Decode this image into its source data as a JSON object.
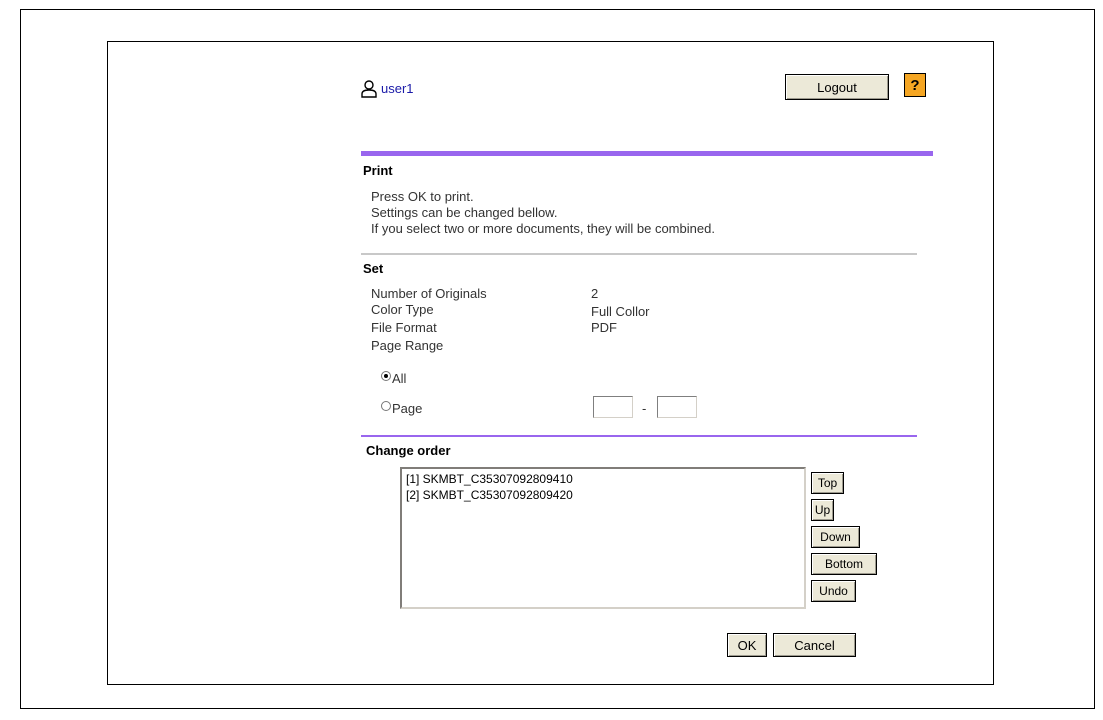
{
  "header": {
    "username": "user1",
    "logout_label": "Logout",
    "help_label": "?"
  },
  "print": {
    "title": "Print",
    "lines": [
      "Press OK to print.",
      "Settings can be changed bellow.",
      "If you select two or more documents, they will be combined."
    ]
  },
  "set": {
    "title": "Set",
    "rows": [
      {
        "label": "Number of Originals",
        "value": "2"
      },
      {
        "label": "Color Type",
        "value": "Full Collor"
      },
      {
        "label": "File Format",
        "value": "PDF"
      },
      {
        "label": "Page Range",
        "value": ""
      }
    ],
    "page_range": {
      "all_label": "All",
      "page_label": "Page",
      "selected": "All",
      "from": "",
      "to": "",
      "separator": "-"
    }
  },
  "change_order": {
    "title": "Change order",
    "items": [
      "[1] SKMBT_C35307092809410",
      "[2] SKMBT_C35307092809420"
    ],
    "buttons": {
      "top": "Top",
      "up": "Up",
      "down": "Down",
      "bottom": "Bottom",
      "undo": "Undo"
    }
  },
  "footer": {
    "ok_label": "OK",
    "cancel_label": "Cancel"
  }
}
